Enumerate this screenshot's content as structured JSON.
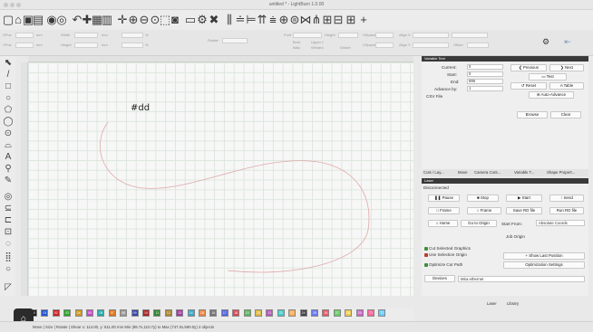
{
  "window": {
    "title": "untitled * - LightBurn 1.0.00"
  },
  "properties_bar": {
    "row1": [
      "XPos",
      "mm",
      "Width",
      "mm",
      "%",
      "Rotate",
      "Font",
      "Height",
      "HSpace",
      "Align X"
    ],
    "row2": [
      "YPos",
      "mm",
      "Height",
      "mm",
      "%",
      "Bold",
      "Italic",
      "Upper Case",
      "Distort",
      "Welded",
      "VSpace",
      "Align Y",
      "Offset"
    ]
  },
  "canvas": {
    "text": "#dd"
  },
  "variable_text": {
    "title": "Variable Text",
    "current_label": "Current:",
    "current_value": "0",
    "start_label": "Start:",
    "start_value": "0",
    "end_label": "End:",
    "end_value": "999",
    "advance_label": "Advance by:",
    "advance_value": "1",
    "csv_label": "CSV File",
    "previous": "Previous",
    "next": "Next",
    "test": "Test",
    "reset": "Reset",
    "table": "Table",
    "auto_advance": "Auto-Advance",
    "browse": "Browse",
    "clear": "Clear"
  },
  "tabs": [
    "Cuts / Lay...",
    "Move",
    "Camera Cont...",
    "Variable T...",
    "Shape Propert..."
  ],
  "laser": {
    "title": "Laser",
    "status": "Disconnected",
    "pause": "Pause",
    "stop": "Stop",
    "start": "Start",
    "send": "Send",
    "frame": "Frame",
    "frame2": "Frame",
    "save_rd": "Save RD file",
    "run_rd": "Run RD file",
    "home": "Home",
    "goto_origin": "Go to Origin",
    "start_from_label": "Start From:",
    "start_from_value": "Absolute Coords",
    "job_origin": "Job Origin",
    "cut_selected": "Cut Selected Graphics",
    "use_selection_origin": "Use Selection Origin",
    "optimize": "Optimize Cut Path",
    "show_last": "Show Last Position",
    "opt_settings": "Optimization Settings",
    "devices": "Devices",
    "device_value": "Mira ethernet"
  },
  "bottom_tabs": [
    "Laser",
    "Library"
  ],
  "swatches": [
    {
      "label": "00",
      "color": "#1a1a1a"
    },
    {
      "label": "01",
      "color": "#2255cc"
    },
    {
      "label": "02",
      "color": "#cc2222"
    },
    {
      "label": "03",
      "color": "#22aa22"
    },
    {
      "label": "04",
      "color": "#cc9922"
    },
    {
      "label": "05",
      "color": "#cc44cc"
    },
    {
      "label": "06",
      "color": "#22aaaa"
    },
    {
      "label": "07",
      "color": "#dd7722"
    },
    {
      "label": "08",
      "color": "#999999"
    },
    {
      "label": "09",
      "color": "#3344aa"
    },
    {
      "label": "10",
      "color": "#aa2222"
    },
    {
      "label": "11",
      "color": "#338833"
    },
    {
      "label": "12",
      "color": "#aa8833"
    },
    {
      "label": "13",
      "color": "#aa33aa"
    },
    {
      "label": "14",
      "color": "#33aacc"
    },
    {
      "label": "15",
      "color": "#ee8844"
    },
    {
      "label": "16",
      "color": "#777777"
    },
    {
      "label": "17",
      "color": "#5566dd"
    },
    {
      "label": "18",
      "color": "#dd4455"
    },
    {
      "label": "19",
      "color": "#55bb55"
    },
    {
      "label": "20",
      "color": "#ddbb44"
    },
    {
      "label": "21",
      "color": "#bb55bb"
    },
    {
      "label": "22",
      "color": "#44cccc"
    },
    {
      "label": "23",
      "color": "#ffaa55"
    },
    {
      "label": "24",
      "color": "#444444"
    },
    {
      "label": "25",
      "color": "#6677ee"
    },
    {
      "label": "26",
      "color": "#ee5566"
    },
    {
      "label": "27",
      "color": "#66cc66"
    },
    {
      "label": "28",
      "color": "#eecc55"
    },
    {
      "label": "29",
      "color": "#cc66cc"
    },
    {
      "label": "T1",
      "color": "#ff6699"
    },
    {
      "label": "T2",
      "color": "#66ccff"
    }
  ],
  "status": {
    "text": "Move | Size | Rotate | Shear   x: 114.00, y: 611.00 mm   Min (88.7x,110.7y) to Max (747.0x,590.0y)  2 objects"
  }
}
